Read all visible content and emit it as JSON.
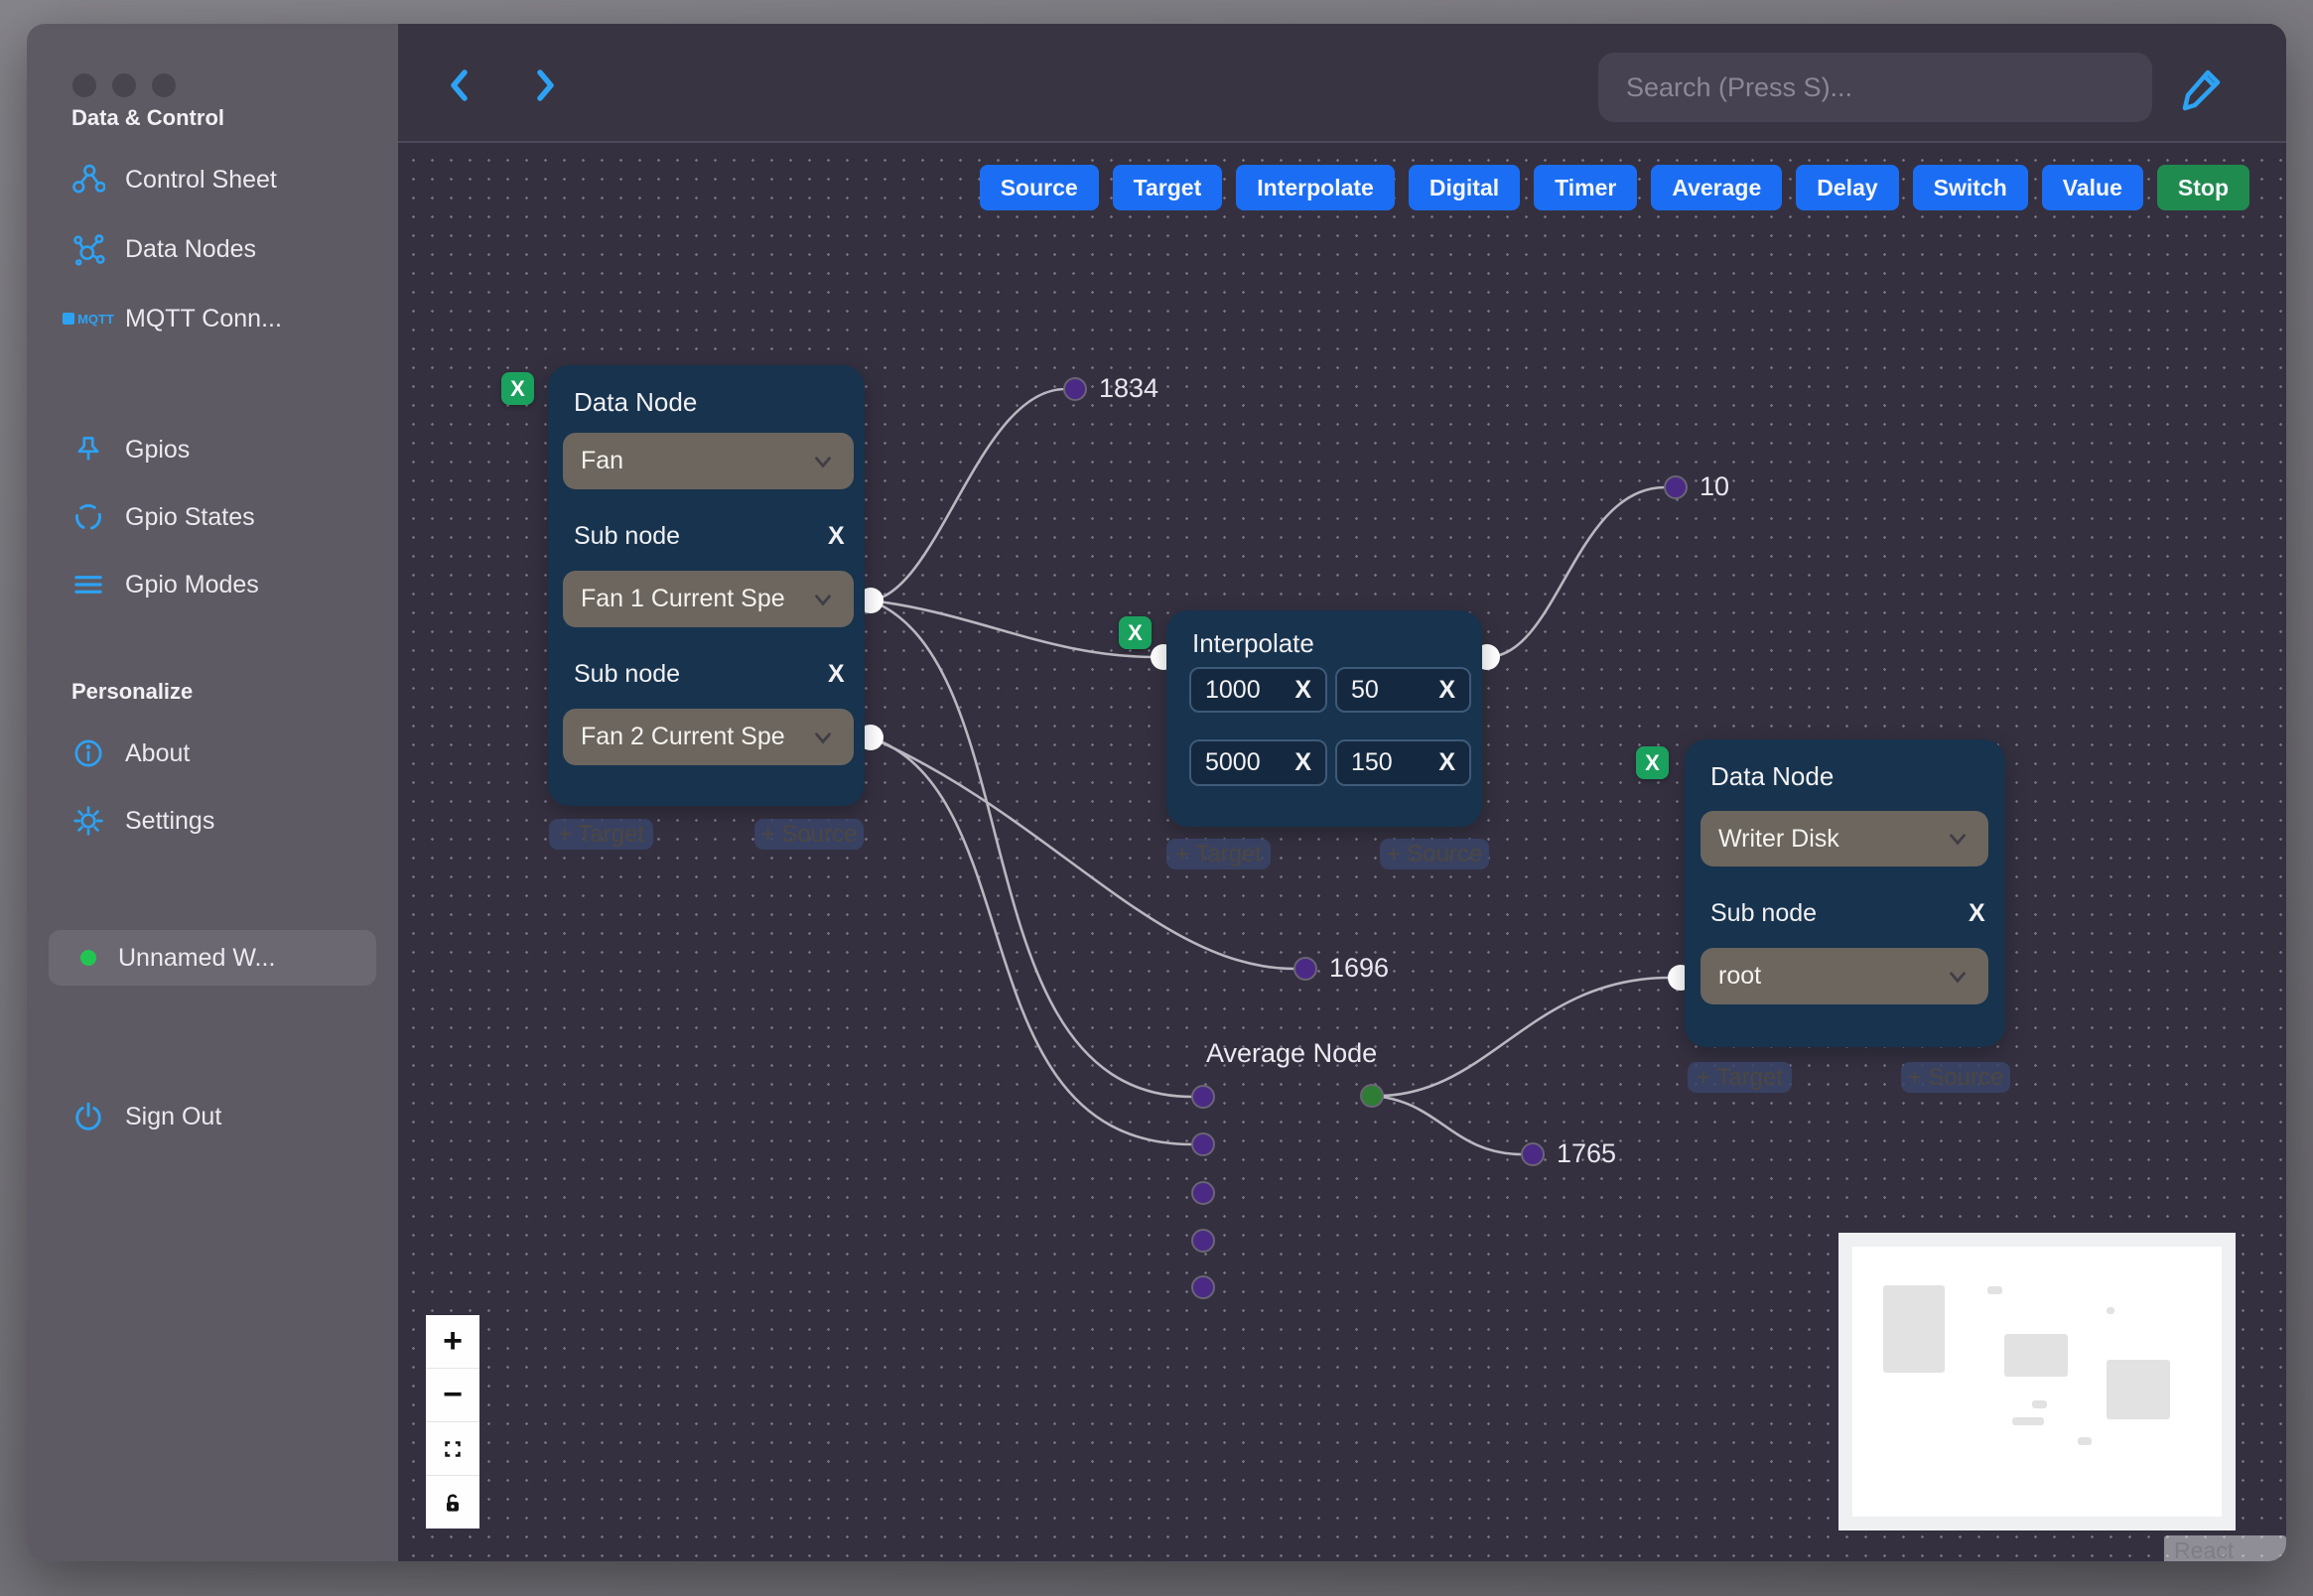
{
  "sidebar": {
    "section1": "Data & Control",
    "control_sheet": "Control Sheet",
    "data_nodes": "Data Nodes",
    "mqtt": "MQTT Conn...",
    "mqtt_icon": "MQTT",
    "gpios": "Gpios",
    "gpio_states": "Gpio States",
    "gpio_modes": "Gpio Modes",
    "section2": "Personalize",
    "about": "About",
    "settings": "Settings",
    "workspace": "Unnamed W...",
    "workspace_status_color": "#23c552",
    "sign_out": "Sign Out",
    "icon_color": "#2da2f4"
  },
  "topbar": {
    "search_placeholder": "Search (Press S)..."
  },
  "toolbar": {
    "buttons": [
      {
        "label": "Source",
        "color": "#1b6ef3"
      },
      {
        "label": "Target",
        "color": "#1b6ef3"
      },
      {
        "label": "Interpolate",
        "color": "#1b6ef3"
      },
      {
        "label": "Digital",
        "color": "#1b6ef3"
      },
      {
        "label": "Timer",
        "color": "#1b6ef3"
      },
      {
        "label": "Average",
        "color": "#1b6ef3"
      },
      {
        "label": "Delay",
        "color": "#1b6ef3"
      },
      {
        "label": "Switch",
        "color": "#1b6ef3"
      },
      {
        "label": "Value",
        "color": "#1b6ef3"
      },
      {
        "label": "Stop",
        "color": "#1f8b4f"
      }
    ]
  },
  "nodes": {
    "badge_x": "X",
    "remove_x": "X",
    "add_target": "+ Target",
    "add_source": "+ Source",
    "fan": {
      "title": "Data Node",
      "device": "Fan",
      "sub_label": "Sub node",
      "sub1_value": "Fan 1 Current Spe",
      "sub2_value": "Fan 2 Current Spe"
    },
    "interpolate": {
      "title": "Interpolate",
      "values": [
        "1000",
        "50",
        "5000",
        "150"
      ]
    },
    "writer": {
      "title": "Data Node",
      "device": "Writer Disk",
      "sub_label": "Sub node",
      "sub_value": "root"
    },
    "average": {
      "title": "Average Node"
    }
  },
  "edges": {
    "labels": {
      "v1834": "1834",
      "v10": "10",
      "v1696": "1696",
      "v1765": "1765"
    },
    "stroke_color": "#b9b7bf",
    "purple_dot_color": "#4b2a85",
    "green_dot_color": "#2f7c35",
    "handle_color": "#ffffff"
  },
  "controls": {
    "zoom_in": "+",
    "zoom_out": "−"
  },
  "attribution": {
    "label": "React Flow"
  }
}
